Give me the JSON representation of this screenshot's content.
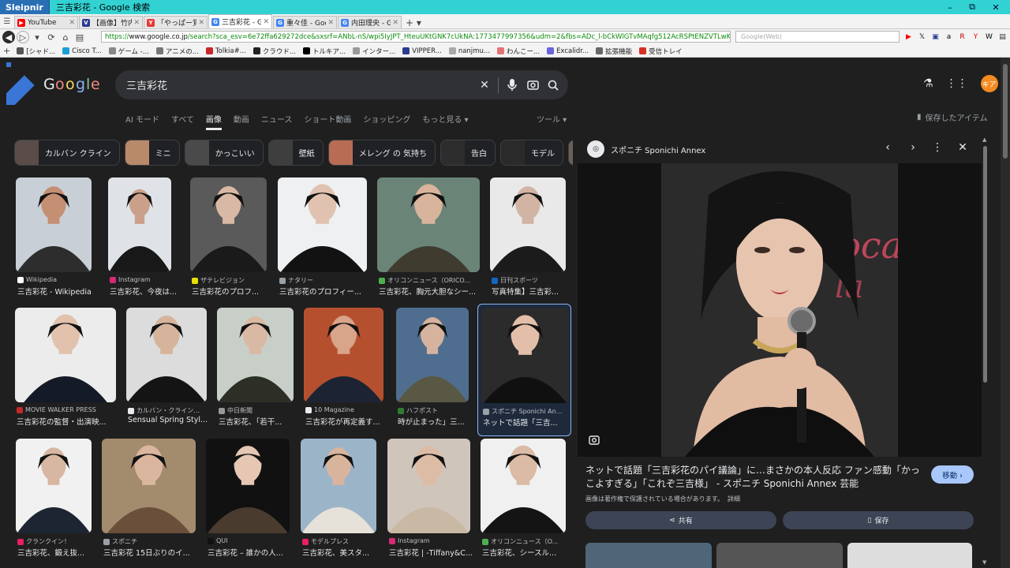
{
  "window": {
    "app": "Sleipnir",
    "title": "三吉彩花 - Google 検索",
    "controls": [
      "🗗",
      "⧉",
      "✕"
    ]
  },
  "tabs": [
    {
      "label": "YouTube",
      "color": "#ff0000",
      "glyph": "▶",
      "active": false
    },
    {
      "label": "【画像】竹内涼真...",
      "color": "#2b3d8f",
      "glyph": "V",
      "active": false
    },
    {
      "label": "「やっぱー覚してる...",
      "color": "#e53935",
      "glyph": "Y",
      "active": false
    },
    {
      "label": "三吉彩花 - Goo...",
      "color": "#4285f4",
      "glyph": "G",
      "active": true
    },
    {
      "label": "重々佳 - Googl...",
      "color": "#4285f4",
      "glyph": "G",
      "active": false
    },
    {
      "label": "内田理央 - Goo...",
      "color": "#4285f4",
      "glyph": "G",
      "active": false
    }
  ],
  "address": {
    "prefix": "https://",
    "host": "www.google.co.jp",
    "path": "/search?sca_esv=6e72ffa629272dce&sxsrf=ANbL-nS/wpi5IyJPT_HteuUKtGNK7cUkNA:1773477997356&udm=2&fbs=ADc_l-bCkWlGTvMAqfg512AcRSPtENZVTLwKuV2t5NIoFZUfYZ_vfv",
    "search_placeholder": "Google(Web)"
  },
  "bookmarks": [
    {
      "label": "[シャド...",
      "color": "#555"
    },
    {
      "label": "Cisco T...",
      "color": "#1ba0d7"
    },
    {
      "label": "ゲーム -...",
      "color": "#888"
    },
    {
      "label": "アニメの...",
      "color": "#777"
    },
    {
      "label": "Tolkia#...",
      "color": "#c62828"
    },
    {
      "label": "クラウド...",
      "color": "#222"
    },
    {
      "label": "トルキア...",
      "color": "#000"
    },
    {
      "label": "インター...",
      "color": "#999"
    },
    {
      "label": "VIPPER...",
      "color": "#2b3d8f"
    },
    {
      "label": "nanjmu...",
      "color": "#aaa"
    },
    {
      "label": "わんこー...",
      "color": "#e57373"
    },
    {
      "label": "Excalidr...",
      "color": "#6965db"
    },
    {
      "label": "拡張機能",
      "color": "#666"
    },
    {
      "label": "受信トレイ",
      "color": "#d93025"
    }
  ],
  "search": {
    "query": "三吉彩花",
    "avatar": "キア"
  },
  "nav": {
    "tabs": [
      {
        "label": "AI モード",
        "active": false
      },
      {
        "label": "すべて",
        "active": false
      },
      {
        "label": "画像",
        "active": true
      },
      {
        "label": "動画",
        "active": false
      },
      {
        "label": "ニュース",
        "active": false
      },
      {
        "label": "ショート動画",
        "active": false
      },
      {
        "label": "ショッピング",
        "active": false
      },
      {
        "label": "もっと見る ▾",
        "active": false
      }
    ],
    "tools": "ツール ▾",
    "saved": "保存したアイテム"
  },
  "chips": [
    "カルバン クライン",
    "ミニ",
    "かっこいい",
    "壁紙",
    "メレング の 気持ち",
    "告白",
    "モデル",
    ""
  ],
  "results": [
    {
      "source": "Wikipedia",
      "title": "三吉彩花 - Wikipedia",
      "fav": "#ffffff"
    },
    {
      "source": "Instagram",
      "title": "三吉彩花、今夜は...",
      "fav": "#d62976"
    },
    {
      "source": "ザテレビジョン",
      "title": "三吉彩花のプロフ...",
      "fav": "#e8e000"
    },
    {
      "source": "ナタリー",
      "title": "三吉彩花のプロフィー...",
      "fav": "#9aa0a6"
    },
    {
      "source": "オリコンニュース（ORICO...",
      "title": "三吉彩花、胸元大胆なシー...",
      "fav": "#4caf50"
    },
    {
      "source": "日刊スポーツ",
      "title": "写真特集】三吉彩...",
      "fav": "#1565c0"
    },
    {
      "source": "MOVIE WALKER PRESS",
      "title": "三吉彩花の監督・出演映...",
      "fav": "#c62828"
    },
    {
      "source": "カルバン・クライン...",
      "title": "Sensual Spring Styl...",
      "fav": "#e8eaed"
    },
    {
      "source": "中日新聞",
      "title": "三吉彩花、「若干...",
      "fav": "#999"
    },
    {
      "source": "10 Magazine",
      "title": "三吉彩花が再定義す...",
      "fav": "#e8eaed"
    },
    {
      "source": "ハフポスト",
      "title": "時が止まった」三...",
      "fav": "#2e7d32"
    },
    {
      "source": "スポニチ Sponichi An...",
      "title": "ネットで話題「三吉...",
      "fav": "#9aa0a6"
    },
    {
      "source": "クランクイン！",
      "title": "三吉彩花、鍛え抜...",
      "fav": "#e91e63"
    },
    {
      "source": "スポニチ",
      "title": "三吉彩花 15日ぶりのイ...",
      "fav": "#9aa0a6"
    },
    {
      "source": "QUI",
      "title": "三吉彩花 – 誰かの人...",
      "fav": "#111"
    },
    {
      "source": "モデルプレス",
      "title": "三吉彩花、美スタ...",
      "fav": "#e91e63"
    },
    {
      "source": "Instagram",
      "title": "三吉彩花 | -Tiffany&C...",
      "fav": "#d62976"
    },
    {
      "source": "オリコンニュース（O...",
      "title": "三吉彩花、シースル...",
      "fav": "#4caf50"
    }
  ],
  "side": {
    "source": "スポニチ Sponichi Annex",
    "title": "ネットで話題「三吉彩花のパイ議論」に…まさかの本人反応 ファン感動「かっこよすぎる」「これぞ三吉様」 - スポニチ Sponichi Annex 芸能",
    "visit": "移動 ›",
    "copyright": "画像は著作権で保護されている場合があります。",
    "more": "詳細",
    "share": "共有",
    "save": "保存"
  }
}
